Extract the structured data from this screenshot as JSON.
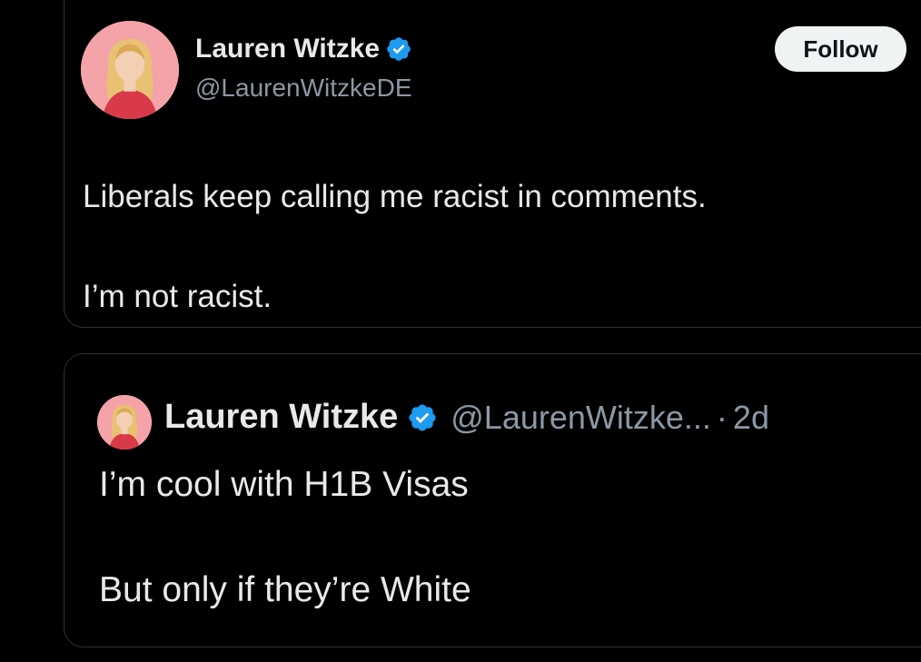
{
  "main_tweet": {
    "author": {
      "display_name": "Lauren Witzke",
      "handle": "@LaurenWitzkeDE",
      "verified": true
    },
    "follow_label": "Follow",
    "text_lines": [
      "Liberals keep calling me racist in comments.",
      "I’m not racist."
    ]
  },
  "quoted_tweet": {
    "author": {
      "display_name": "Lauren Witzke",
      "handle": "@LaurenWitzke...",
      "verified": true
    },
    "separator": "·",
    "timestamp": "2d",
    "text_lines": [
      "I’m cool with H1B Visas",
      "But only if they’re White"
    ]
  },
  "icons": {
    "verified": "verified-badge-icon",
    "avatar": "profile-photo"
  },
  "colors": {
    "background": "#000000",
    "text_primary": "#e7e9ea",
    "text_secondary": "#8b98a5",
    "verified_blue": "#1d9bf0",
    "follow_button_bg": "#eff3f4",
    "border": "#2f3336"
  }
}
